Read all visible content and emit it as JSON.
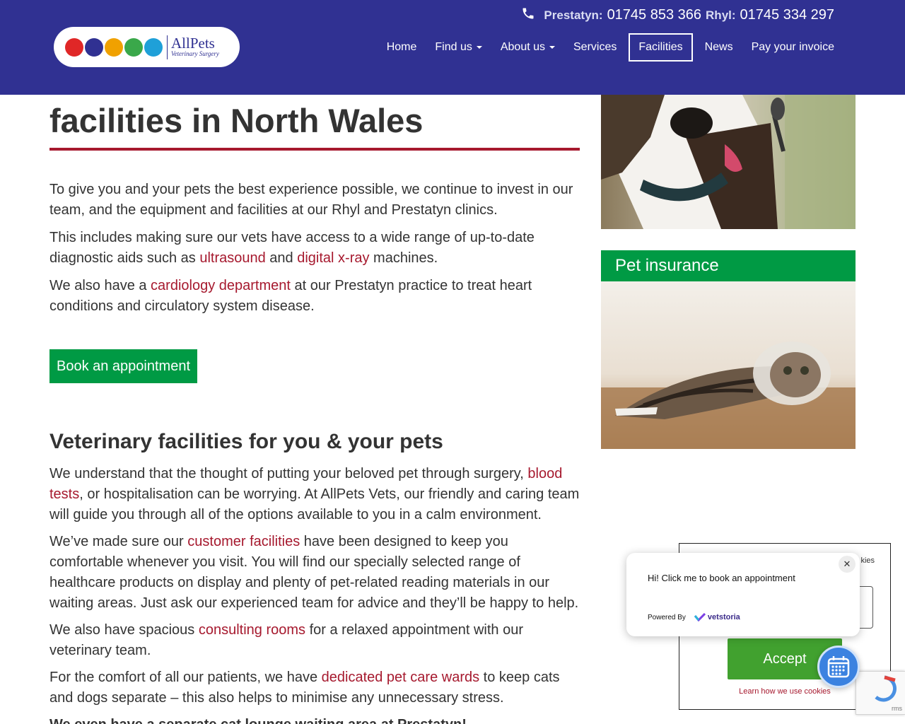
{
  "header": {
    "phones": [
      {
        "label": "Prestatyn:",
        "number": "01745 853 366"
      },
      {
        "label": "Rhyl:",
        "number": "01745 334 297"
      }
    ],
    "logo": {
      "name": "AllPets",
      "subtitle": "Veterinary Surgery"
    }
  },
  "nav": {
    "items": [
      {
        "label": "Home"
      },
      {
        "label": "Find us",
        "dropdown": true
      },
      {
        "label": "About us",
        "dropdown": true
      },
      {
        "label": "Services"
      },
      {
        "label": "Facilities",
        "active": true
      },
      {
        "label": "News"
      },
      {
        "label": "Pay your invoice"
      }
    ]
  },
  "main": {
    "title": "facilities in North Wales",
    "intro": {
      "p1": "To give you and your pets the best experience possible, we continue to invest in our team, and the equipment and facilities at our Rhyl and Prestatyn clinics.",
      "p2_a": "This includes making sure our vets have access to a wide range of up-to-date diagnostic aids such as ",
      "p2_link1": "ultrasound",
      "p2_b": " and ",
      "p2_link2": "digital x-ray",
      "p2_c": " machines.",
      "p3_a": "We also have a ",
      "p3_link": "cardiology department",
      "p3_b": " at our Prestatyn practice to treat heart conditions and circulatory system disease."
    },
    "book_button": "Book an appointment",
    "subheading": "Veterinary facilities for you & your pets",
    "body": {
      "p1_a": "We understand that the thought of putting your beloved pet through surgery, ",
      "p1_link": "blood tests",
      "p1_b": ", or hospitalisation can be worrying. At AllPets Vets, our friendly and caring team will guide you through all of the options available to you in a calm environment.",
      "p2_a": "We’ve made sure our ",
      "p2_link": "customer facilities",
      "p2_b": " have been designed to keep you comfortable whenever you visit. You will find our specially selected range of healthcare products on display and plenty of pet-related reading materials in our waiting areas. Just ask our experienced team for advice and they’ll be happy to help.",
      "p3_a": "We also have spacious ",
      "p3_link": "consulting rooms",
      "p3_b": " for a relaxed appointment with our veterinary team.",
      "p4_a": "For the comfort of all our patients, we have ",
      "p4_link": "dedicated pet care wards",
      "p4_b": " to keep cats and dogs separate – this also helps to minimise any unnecessary stress.",
      "p5": "We even have a separate cat lounge waiting area at Prestatyn!"
    }
  },
  "sidebar": {
    "insurance_heading": "Pet insurance"
  },
  "cookie": {
    "top_text": "kies",
    "accept": "Accept",
    "learn_link": "Learn how we use cookies"
  },
  "recaptcha": {
    "terms": "rms"
  },
  "booking_popup": {
    "message": "Hi! Click me to book an appointment",
    "close": "✕",
    "powered_by": "Powered By",
    "brand": "vetstoria"
  },
  "colors": {
    "header_bg": "#303192",
    "accent_red": "#a6192e",
    "green": "#009a44",
    "accept_green": "#41a12f"
  }
}
